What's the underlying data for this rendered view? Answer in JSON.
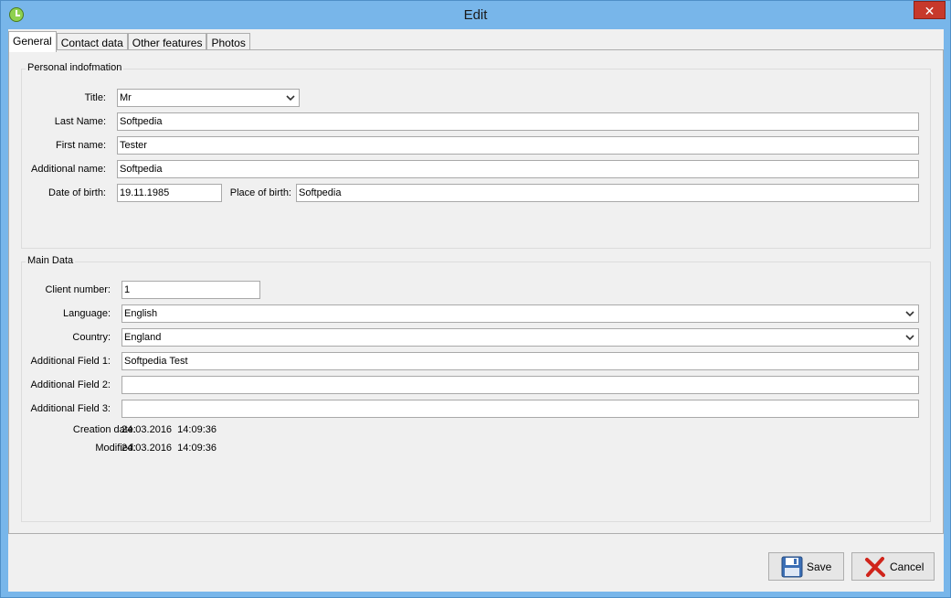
{
  "window": {
    "title": "Edit",
    "close_glyph": "✕"
  },
  "tabs": [
    {
      "label": "General",
      "active": true
    },
    {
      "label": "Contact data",
      "active": false
    },
    {
      "label": "Other features",
      "active": false
    },
    {
      "label": "Photos",
      "active": false
    }
  ],
  "personal": {
    "group_title": "Personal indofmation",
    "title_label": "Title:",
    "title_value": "Mr",
    "last_name_label": "Last Name:",
    "last_name_value": "Softpedia",
    "first_name_label": "First name:",
    "first_name_value": "Tester",
    "additional_name_label": "Additional name:",
    "additional_name_value": "Softpedia",
    "dob_label": "Date of birth:",
    "dob_value": "19.11.1985",
    "pob_label": "Place of birth:",
    "pob_value": "Softpedia"
  },
  "main": {
    "group_title": "Main Data",
    "client_number_label": "Client number:",
    "client_number_value": "1",
    "language_label": "Language:",
    "language_value": "English",
    "country_label": "Country:",
    "country_value": "England",
    "field1_label": "Additional Field 1:",
    "field1_value": "Softpedia Test",
    "field2_label": "Additional Field 2:",
    "field2_value": "",
    "field3_label": "Additional Field 3:",
    "field3_value": "",
    "creation_label": "Creation date:",
    "creation_value": "24.03.2016  14:09:36",
    "modified_label": "Modified:",
    "modified_value": "24.03.2016  14:09:36"
  },
  "buttons": {
    "save_label": "Save",
    "cancel_label": "Cancel"
  },
  "icons": {
    "app": "clock-icon",
    "save": "floppy-disk-icon",
    "cancel": "red-x-icon",
    "dropdown": "chevron-down-icon"
  }
}
